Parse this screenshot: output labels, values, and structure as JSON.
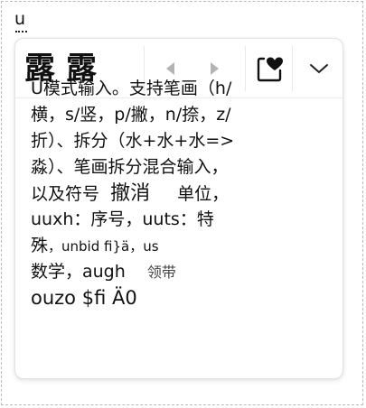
{
  "composition": {
    "text": "u"
  },
  "candidates": [
    "露",
    "露"
  ],
  "toolbar": {
    "prev_icon": "triangle-left-icon",
    "next_icon": "triangle-right-icon",
    "favorite_icon": "heart-card-icon",
    "expand_icon": "chevron-down-icon"
  },
  "help": {
    "lines": [
      "U模式输入。支持笔画（h/",
      "横，s/竖，p/撇，n/捺，z/",
      "折）、拆分（水+水+水=>",
      "淼）、笔画拆分混合输入，"
    ],
    "line5": {
      "a": "以及符号",
      "b": "撤消",
      "c": "单位，"
    },
    "line6": "uuxh：序号，uuts：特",
    "line7": {
      "a": "殊",
      "b": "，unbid fi}ä，us"
    },
    "line8": {
      "a": "数学，augh",
      "b": "领带"
    },
    "line9": "ouzo $fi Ä0"
  },
  "colors": {
    "accent_border": "#e3e3e3",
    "icon_gray": "#b3b3b3",
    "text": "#111111"
  }
}
